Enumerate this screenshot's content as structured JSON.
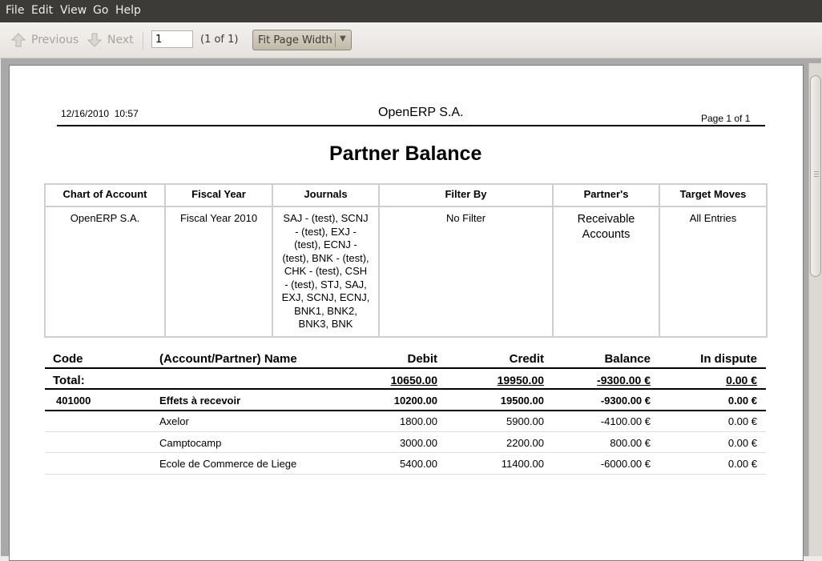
{
  "menu": [
    "File",
    "Edit",
    "View",
    "Go",
    "Help"
  ],
  "toolbar": {
    "previous_label": "Previous",
    "next_label": "Next",
    "page_value": "1",
    "page_count": "(1 of 1)",
    "zoom_label": "Fit Page Width"
  },
  "report": {
    "date": "12/16/2010",
    "time": "10:57",
    "company": "OpenERP S.A.",
    "page": "Page 1 of 1",
    "title": "Partner Balance",
    "filter_headers": [
      "Chart of Account",
      "Fiscal Year",
      "Journals",
      "Filter By",
      "Partner's",
      "Target Moves"
    ],
    "filter_values": {
      "chart": "OpenERP S.A.",
      "fiscal_year": "Fiscal Year 2010",
      "journals_lines": [
        "SAJ - (test), SCNJ",
        "- (test), EXJ -",
        "(test), ECNJ -",
        "(test), BNK - (test),",
        "CHK - (test), CSH",
        "- (test), STJ, SAJ,",
        "EXJ, SCNJ, ECNJ,",
        "BNK1, BNK2,",
        "BNK3, BNK"
      ],
      "filter_by": "No Filter",
      "partners_lines": [
        "Receivable",
        "Accounts"
      ],
      "target_moves": "All Entries"
    },
    "columns": [
      "Code",
      "(Account/Partner) Name",
      "Debit",
      "Credit",
      "Balance",
      "In dispute"
    ],
    "total": {
      "label": "Total:",
      "debit": "10650.00",
      "credit": "19950.00",
      "balance": "-9300.00 €",
      "dispute": "0.00 €"
    },
    "account": {
      "code": "401000",
      "name": "Effets à recevoir",
      "debit": "10200.00",
      "credit": "19500.00",
      "balance": "-9300.00 €",
      "dispute": "0.00 €"
    },
    "rows": [
      {
        "name": "Axelor",
        "debit": "1800.00",
        "credit": "5900.00",
        "balance": "-4100.00 €",
        "dispute": "0.00 €"
      },
      {
        "name": "Camptocamp",
        "debit": "3000.00",
        "credit": "2200.00",
        "balance": "800.00 €",
        "dispute": "0.00 €"
      },
      {
        "name": "Ecole de Commerce de Liege",
        "debit": "5400.00",
        "credit": "11400.00",
        "balance": "-6000.00 €",
        "dispute": "0.00 €"
      }
    ]
  }
}
